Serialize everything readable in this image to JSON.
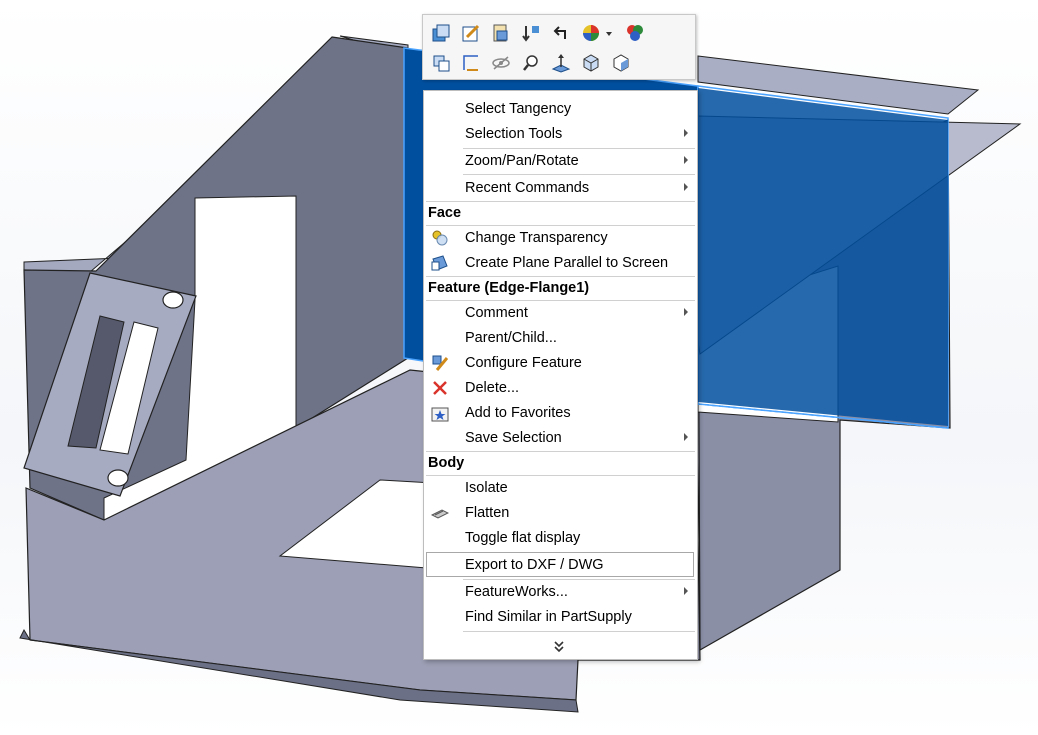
{
  "toolbar": {
    "row1": [
      "zoom-to-selection-icon",
      "edit-sketch-icon",
      "feature-properties-icon",
      "rollback-icon",
      "undo-icon",
      "appearance-icon",
      "appearance-dropdown-icon",
      "colors-icon"
    ],
    "row2": [
      "select-other-icon",
      "sketch-icon",
      "hide-icon",
      "zoom-icon",
      "normal-to-icon",
      "view-orientation-icon",
      "isometric-icon"
    ]
  },
  "menu": {
    "items_top": [
      {
        "label": "Select Tangency",
        "submenu": false
      },
      {
        "label": "Selection Tools",
        "submenu": true
      },
      {
        "label": "Zoom/Pan/Rotate",
        "submenu": true
      },
      {
        "label": "Recent Commands",
        "submenu": true
      }
    ],
    "face_header": "Face",
    "face_items": [
      {
        "label": "Change Transparency",
        "icon": "transparency-icon"
      },
      {
        "label": "Create Plane Parallel to Screen",
        "icon": "plane-icon"
      }
    ],
    "feature_header": "Feature (Edge-Flange1)",
    "feature_items": [
      {
        "label": "Comment",
        "submenu": true
      },
      {
        "label": "Parent/Child...",
        "submenu": false
      },
      {
        "label": "Configure Feature",
        "icon": "configure-icon"
      },
      {
        "label": "Delete...",
        "icon": "delete-icon"
      },
      {
        "label": "Add to Favorites",
        "icon": "favorites-icon"
      },
      {
        "label": "Save Selection",
        "submenu": true
      }
    ],
    "body_header": "Body",
    "body_items": [
      {
        "label": "Isolate"
      },
      {
        "label": "Flatten",
        "icon": "flatten-icon"
      },
      {
        "label": "Toggle flat display"
      },
      {
        "label": "Export to DXF / DWG",
        "highlighted": true
      },
      {
        "label": "FeatureWorks...",
        "submenu": true
      },
      {
        "label": "Find Similar in PartSupply"
      }
    ],
    "more_icon": "chevron-double-down-icon"
  },
  "colors": {
    "selected_face": "#0050a0",
    "metal": "#9a9fb8",
    "metal_dark": "#6d7186",
    "metal_light": "#c2c6d6"
  }
}
